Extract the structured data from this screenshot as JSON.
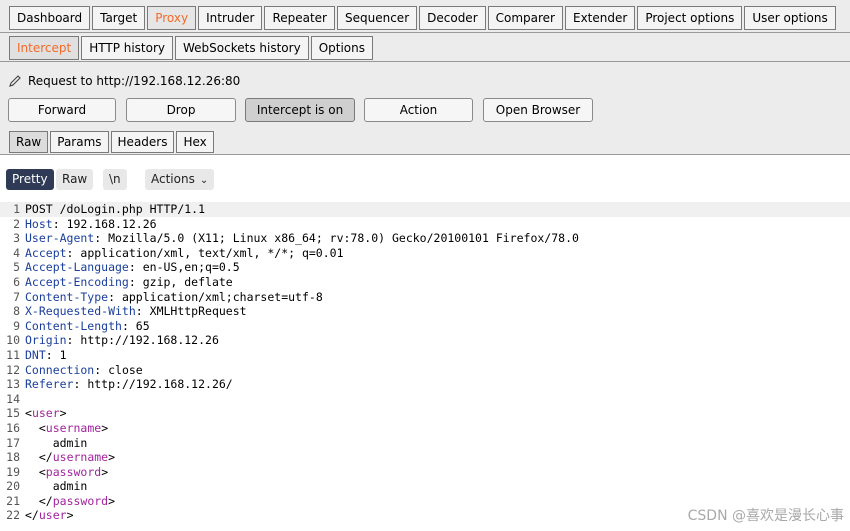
{
  "main_tabs": [
    "Dashboard",
    "Target",
    "Proxy",
    "Intruder",
    "Repeater",
    "Sequencer",
    "Decoder",
    "Comparer",
    "Extender",
    "Project options",
    "User options"
  ],
  "active_main_tab": "Proxy",
  "proxy_tabs": [
    "Intercept",
    "HTTP history",
    "WebSockets history",
    "Options"
  ],
  "active_proxy_tab": "Intercept",
  "request_target": "Request to http://192.168.12.26:80",
  "buttons": {
    "forward": "Forward",
    "drop": "Drop",
    "intercept": "Intercept is on",
    "action": "Action",
    "open_browser": "Open Browser"
  },
  "view_tabs": [
    "Raw",
    "Params",
    "Headers",
    "Hex"
  ],
  "active_view_tab": "Raw",
  "editor_toolbar": {
    "pretty": "Pretty",
    "raw": "Raw",
    "newline": "\\n",
    "actions": "Actions"
  },
  "colors": {
    "active_tab_text": "#f26b2a",
    "header_key": "#1a3e9c",
    "xml_tag": "#a1249e",
    "pretty_pill_bg": "#2e3a56"
  },
  "request": {
    "request_line": "POST /doLogin.php HTTP/1.1",
    "headers": [
      {
        "key": "Host",
        "value": "192.168.12.26"
      },
      {
        "key": "User-Agent",
        "value": "Mozilla/5.0 (X11; Linux x86_64; rv:78.0) Gecko/20100101 Firefox/78.0"
      },
      {
        "key": "Accept",
        "value": "application/xml, text/xml, */*; q=0.01"
      },
      {
        "key": "Accept-Language",
        "value": "en-US,en;q=0.5"
      },
      {
        "key": "Accept-Encoding",
        "value": "gzip, deflate"
      },
      {
        "key": "Content-Type",
        "value": "application/xml;charset=utf-8"
      },
      {
        "key": "X-Requested-With",
        "value": "XMLHttpRequest"
      },
      {
        "key": "Content-Length",
        "value": "65"
      },
      {
        "key": "Origin",
        "value": "http://192.168.12.26"
      },
      {
        "key": "DNT",
        "value": "1"
      },
      {
        "key": "Connection",
        "value": "close"
      },
      {
        "key": "Referer",
        "value": "http://192.168.12.26/"
      }
    ],
    "body_lines": [
      {
        "indent": "",
        "open": "user",
        "text": "",
        "close": ""
      },
      {
        "indent": "  ",
        "open": "username",
        "text": "",
        "close": ""
      },
      {
        "indent": "    ",
        "open": "",
        "text": "admin",
        "close": ""
      },
      {
        "indent": "  ",
        "open": "",
        "text": "",
        "close": "username"
      },
      {
        "indent": "  ",
        "open": "password",
        "text": "",
        "close": ""
      },
      {
        "indent": "    ",
        "open": "",
        "text": "admin",
        "close": ""
      },
      {
        "indent": "  ",
        "open": "",
        "text": "",
        "close": "password"
      },
      {
        "indent": "",
        "open": "",
        "text": "",
        "close": "user"
      }
    ]
  },
  "watermark": "CSDN @喜欢是漫长心事"
}
